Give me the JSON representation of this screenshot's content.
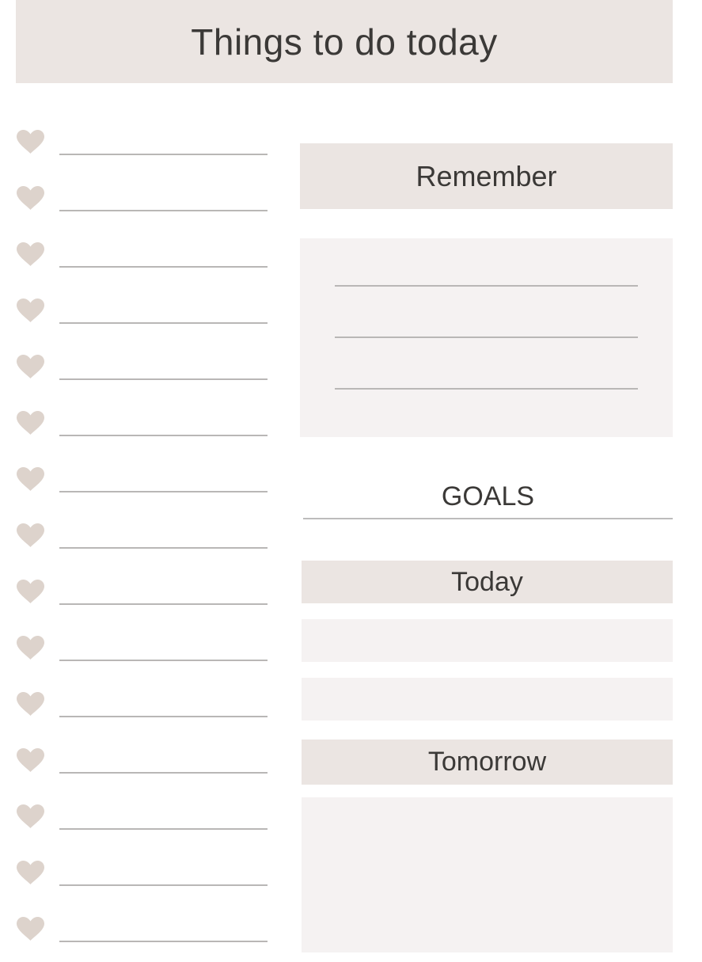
{
  "title": "Things to do today",
  "todo_list": {
    "item_count": 15,
    "bullet_icon": "heart-icon",
    "items": [
      "",
      "",
      "",
      "",
      "",
      "",
      "",
      "",
      "",
      "",
      "",
      "",
      "",
      "",
      ""
    ]
  },
  "remember": {
    "label": "Remember",
    "lines": [
      "",
      "",
      ""
    ]
  },
  "goals": {
    "label": "GOALS",
    "today": {
      "label": "Today",
      "entries": [
        "",
        ""
      ]
    },
    "tomorrow": {
      "label": "Tomorrow",
      "entry": ""
    }
  },
  "colors": {
    "header_fill": "#ebe5e2",
    "panel_fill": "#f5f2f2",
    "heart": "#ddd3cc",
    "rule": "#b9b7b6",
    "text": "#3b3937"
  }
}
